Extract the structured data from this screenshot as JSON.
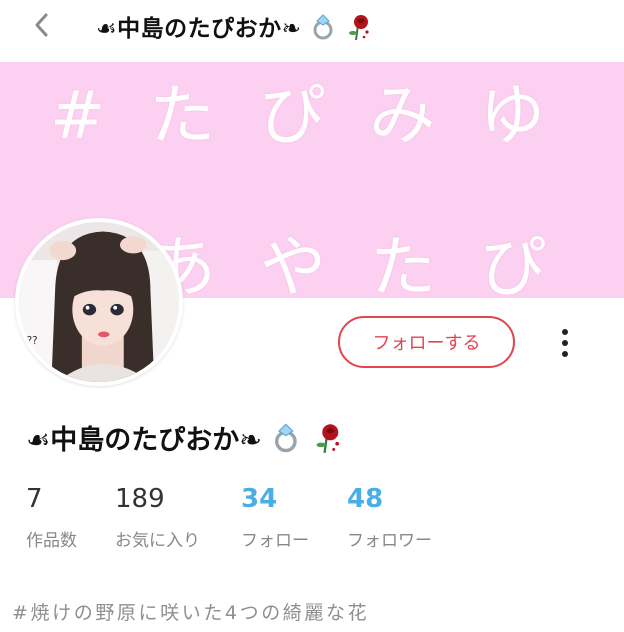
{
  "header": {
    "title": "☙中島のたぴおか❧",
    "back_icon": "chevron-left-icon"
  },
  "cover": {
    "line1": "#たぴみゆ",
    "line2": "あやたぴ",
    "background_color": "#fcd0f0"
  },
  "profile": {
    "name": "☙中島のたぴおか❧",
    "name_emojis": [
      "ring-icon",
      "rose-icon"
    ],
    "follow_button_label": "フォローする",
    "more_icon": "more-vertical-icon",
    "accent_color": "#e2454f"
  },
  "stats": [
    {
      "count": "7",
      "label": "作品数"
    },
    {
      "count": "189",
      "label": "お気に入り"
    },
    {
      "count": "34",
      "label": "フォロー"
    },
    {
      "count": "48",
      "label": "フォロワー"
    }
  ],
  "stats_highlight_color": "#4aaee6",
  "bio": "#焼けの野原に咲いた4つの綺麗な花"
}
